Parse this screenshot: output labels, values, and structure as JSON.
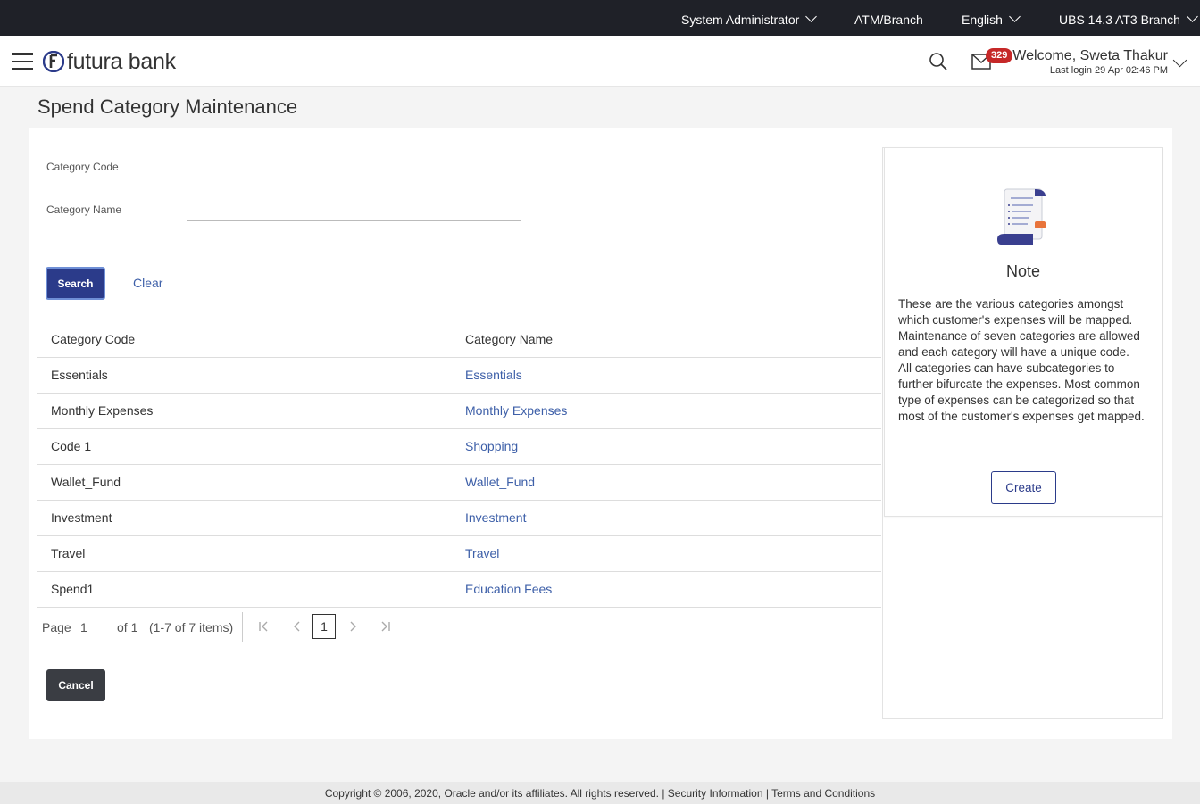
{
  "topbar": {
    "role": "System Administrator",
    "atm_branch": "ATM/Branch",
    "language": "English",
    "branch": "UBS 14.3 AT3 Branch"
  },
  "header": {
    "logo_text": "futura bank",
    "mail_count": "329",
    "welcome": "Welcome, Sweta Thakur",
    "last_login": "Last login 29 Apr 02:46 PM"
  },
  "page": {
    "title": "Spend Category Maintenance"
  },
  "form": {
    "category_code_label": "Category Code",
    "category_code_value": "",
    "category_name_label": "Category Name",
    "category_name_value": "",
    "search_label": "Search",
    "clear_label": "Clear"
  },
  "table": {
    "columns": [
      "Category Code",
      "Category Name"
    ],
    "rows": [
      {
        "code": "Essentials",
        "name": "Essentials"
      },
      {
        "code": "Monthly Expenses",
        "name": "Monthly Expenses"
      },
      {
        "code": "Code 1",
        "name": "Shopping"
      },
      {
        "code": "Wallet_Fund",
        "name": "Wallet_Fund"
      },
      {
        "code": "Investment",
        "name": "Investment"
      },
      {
        "code": "Travel",
        "name": "Travel"
      },
      {
        "code": "Spend1",
        "name": "Education Fees"
      }
    ]
  },
  "pagination": {
    "page_label": "Page",
    "page_value": "1",
    "of_label": "of 1",
    "items_label": "(1-7 of 7 items)",
    "current": "1"
  },
  "actions": {
    "cancel_label": "Cancel"
  },
  "note": {
    "title": "Note",
    "text1": "These are the various categories amongst which customer's expenses will be mapped. Maintenance of seven categories are allowed and each category will have a unique code.",
    "text2": "All categories can have subcategories to further bifurcate the expenses. Most common type of expenses can be categorized so that most of the customer's expenses get mapped.",
    "create_label": "Create"
  },
  "footer": {
    "copyright": "Copyright © 2006, 2020, Oracle and/or its affiliates. All rights reserved.",
    "security": "Security Information",
    "terms": "Terms and Conditions"
  },
  "colors": {
    "primary": "#2b3b8a",
    "link": "#3d5fa8",
    "topbar": "#1f2128",
    "badge": "#c62828"
  }
}
